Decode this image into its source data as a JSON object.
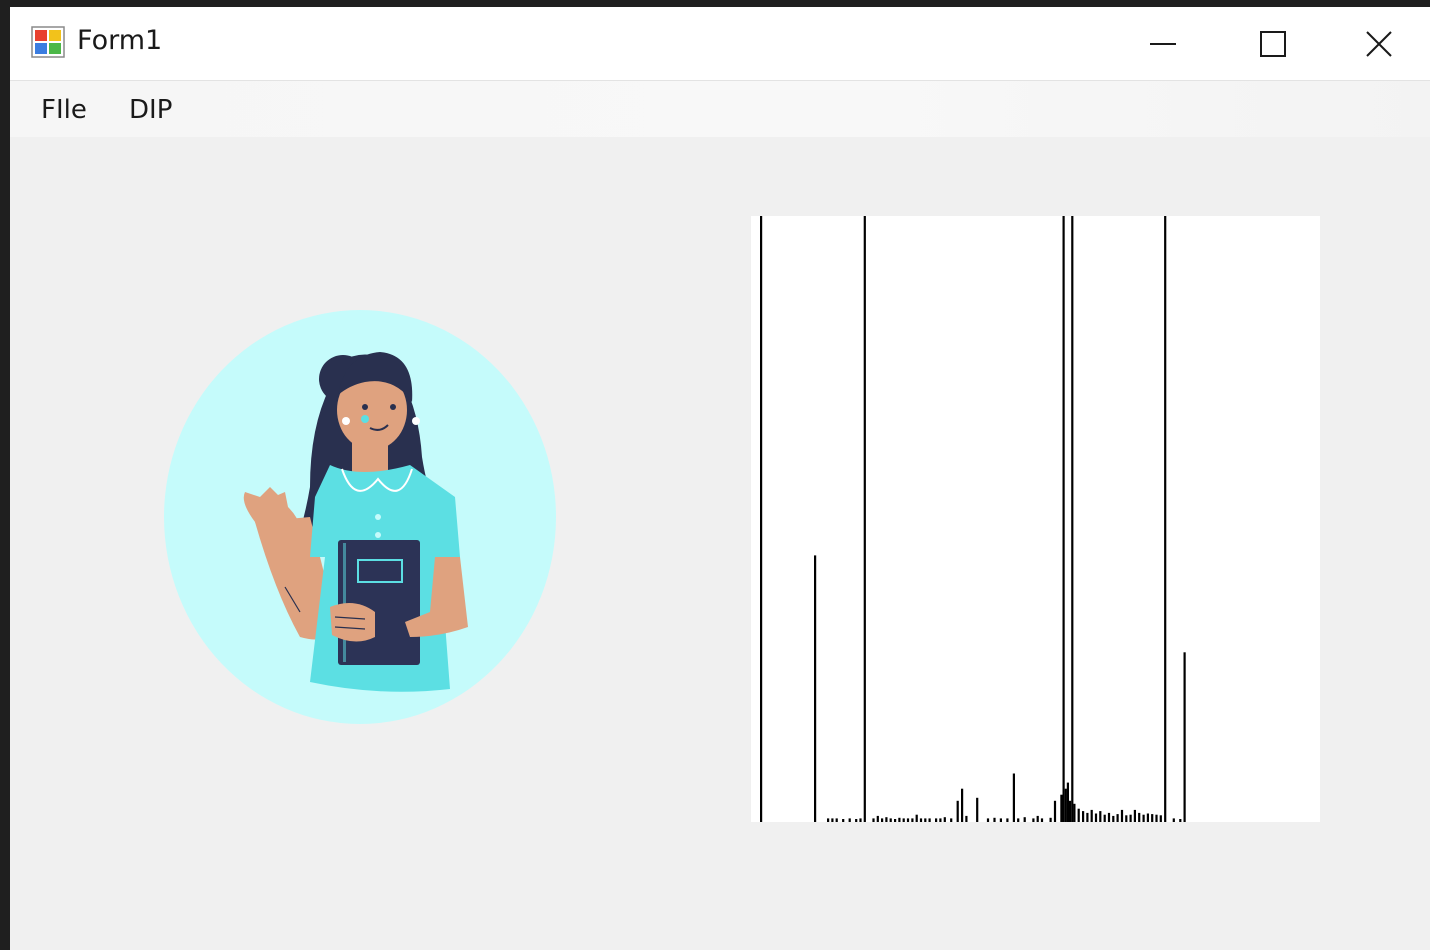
{
  "window": {
    "title": "Form1",
    "controls": {
      "minimize": "minimize-icon",
      "maximize": "maximize-icon",
      "close": "close-icon"
    }
  },
  "menu": {
    "items": [
      {
        "label": "FIle"
      },
      {
        "label": "DIP"
      }
    ]
  },
  "colors": {
    "illustration_bg": "#c5fbfb",
    "shirt": "#5cdfe3",
    "skin": "#dfa27f",
    "hair": "#29304f",
    "book": "#2c3356",
    "histogram_bar": "#000000"
  },
  "chart_data": {
    "type": "bar",
    "x_range": [
      0,
      255
    ],
    "y_range": [
      0,
      1
    ],
    "bars": [
      [
        0,
        1.0
      ],
      [
        25,
        0.44
      ],
      [
        48,
        1.0
      ],
      [
        140,
        1.0
      ],
      [
        144,
        1.0
      ],
      [
        187,
        1.0
      ],
      [
        196,
        0.28
      ],
      [
        31,
        0.006
      ],
      [
        33,
        0.006
      ],
      [
        35,
        0.006
      ],
      [
        38,
        0.005
      ],
      [
        41,
        0.006
      ],
      [
        44,
        0.005
      ],
      [
        46,
        0.006
      ],
      [
        52,
        0.006
      ],
      [
        54,
        0.01
      ],
      [
        56,
        0.006
      ],
      [
        58,
        0.008
      ],
      [
        60,
        0.006
      ],
      [
        62,
        0.005
      ],
      [
        64,
        0.007
      ],
      [
        66,
        0.006
      ],
      [
        68,
        0.006
      ],
      [
        70,
        0.006
      ],
      [
        72,
        0.012
      ],
      [
        74,
        0.006
      ],
      [
        76,
        0.006
      ],
      [
        78,
        0.006
      ],
      [
        81,
        0.006
      ],
      [
        83,
        0.006
      ],
      [
        85,
        0.008
      ],
      [
        88,
        0.006
      ],
      [
        91,
        0.035
      ],
      [
        93,
        0.055
      ],
      [
        95,
        0.01
      ],
      [
        100,
        0.04
      ],
      [
        105,
        0.006
      ],
      [
        108,
        0.007
      ],
      [
        111,
        0.006
      ],
      [
        114,
        0.006
      ],
      [
        117,
        0.08
      ],
      [
        119,
        0.006
      ],
      [
        122,
        0.008
      ],
      [
        126,
        0.006
      ],
      [
        128,
        0.01
      ],
      [
        130,
        0.006
      ],
      [
        134,
        0.007
      ],
      [
        136,
        0.035
      ],
      [
        139,
        0.045
      ],
      [
        141,
        0.055
      ],
      [
        142,
        0.065
      ],
      [
        143,
        0.035
      ],
      [
        145,
        0.03
      ],
      [
        147,
        0.022
      ],
      [
        149,
        0.018
      ],
      [
        151,
        0.015
      ],
      [
        153,
        0.02
      ],
      [
        155,
        0.014
      ],
      [
        157,
        0.018
      ],
      [
        159,
        0.012
      ],
      [
        161,
        0.015
      ],
      [
        163,
        0.01
      ],
      [
        165,
        0.013
      ],
      [
        167,
        0.02
      ],
      [
        169,
        0.011
      ],
      [
        171,
        0.012
      ],
      [
        173,
        0.02
      ],
      [
        175,
        0.015
      ],
      [
        177,
        0.012
      ],
      [
        179,
        0.014
      ],
      [
        181,
        0.013
      ],
      [
        183,
        0.012
      ],
      [
        185,
        0.011
      ],
      [
        191,
        0.006
      ],
      [
        194,
        0.005
      ]
    ]
  }
}
